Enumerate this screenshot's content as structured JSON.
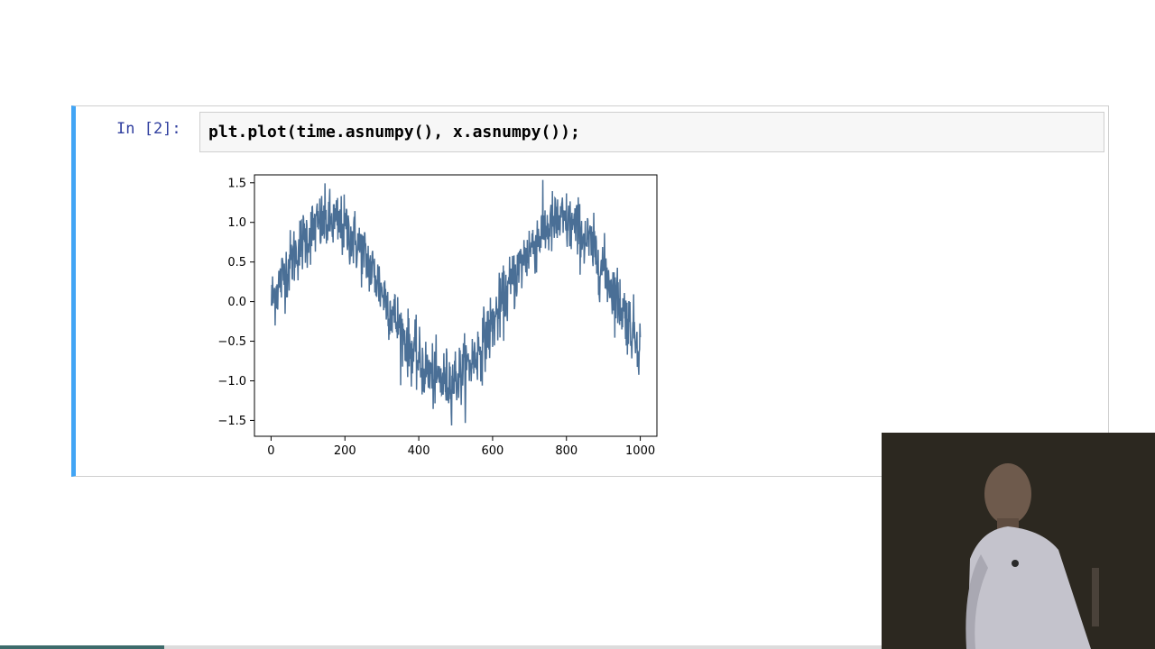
{
  "cell": {
    "prompt": "In [2]:",
    "code": "plt.plot(time.asnumpy(), x.asnumpy());"
  },
  "chart_data": {
    "type": "line",
    "title": "",
    "xlabel": "",
    "ylabel": "",
    "xlim": [
      -45,
      1045
    ],
    "ylim": [
      -1.7,
      1.6
    ],
    "xticks": [
      0,
      200,
      400,
      600,
      800,
      1000
    ],
    "yticks": [
      -1.5,
      -1.0,
      -0.5,
      0.0,
      0.5,
      1.0,
      1.5
    ],
    "xtick_labels": [
      "0",
      "200",
      "400",
      "600",
      "800",
      "1000"
    ],
    "ytick_labels": [
      "−1.5",
      "−1.0",
      "−0.5",
      "0.0",
      "0.5",
      "1.0",
      "1.5"
    ],
    "grid": false,
    "line_color": "#4a6f96",
    "series": [
      {
        "description": "noisy sine: sin(0.01*t) + noise(std≈0.2), t = 1..1000",
        "x_start": 1,
        "x_end": 1000,
        "noise_std": 0.2
      }
    ]
  },
  "colors": {
    "cell_border_accent": "#42a5f5",
    "prompt": "#303f9f",
    "code_background": "#f7f7f7"
  }
}
